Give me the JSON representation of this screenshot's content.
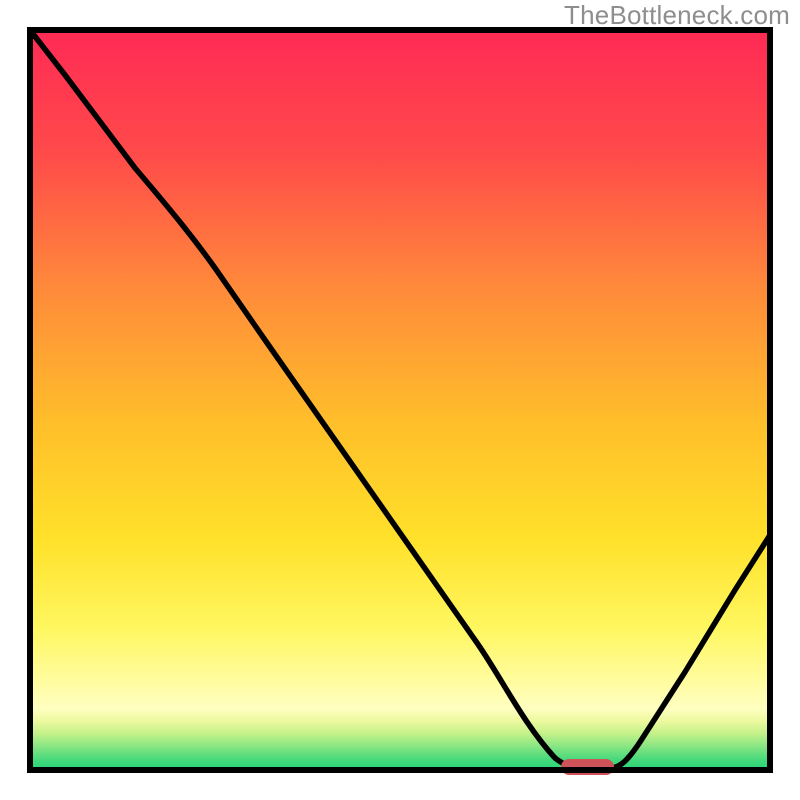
{
  "watermark": "TheBottleneck.com",
  "chart_data": {
    "type": "line",
    "title": "",
    "xlabel": "",
    "ylabel": "",
    "xlim": [
      0,
      100
    ],
    "ylim": [
      0,
      100
    ],
    "grid": false,
    "legend": false,
    "background_gradient": {
      "top": "#ff2a55",
      "middle": "#ffd200",
      "bottom_pale": "#ffffc0",
      "bottom_band": "#2be07a"
    },
    "annotations": [
      {
        "name": "marker",
        "shape": "pill",
        "color": "#cd5358",
        "x": 75,
        "y": 0
      }
    ],
    "series": [
      {
        "name": "bottleneck-curve",
        "x": [
          0,
          5,
          15,
          22,
          30,
          40,
          50,
          60,
          66,
          70,
          74,
          78,
          82,
          88,
          95,
          100
        ],
        "values": [
          100,
          94,
          81,
          72,
          60,
          46,
          33,
          19,
          10,
          4,
          0.5,
          0.5,
          3,
          13,
          24,
          32
        ]
      }
    ]
  }
}
